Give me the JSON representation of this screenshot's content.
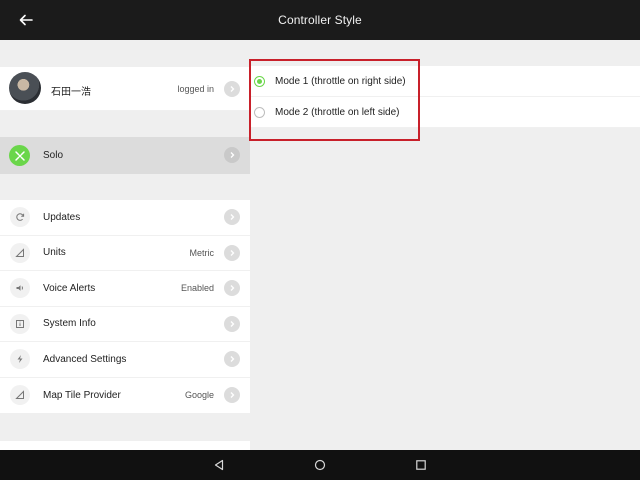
{
  "header": {
    "title": "Controller Style"
  },
  "profile": {
    "name": "石田一浩",
    "status": "logged in"
  },
  "solo": {
    "label": "Solo"
  },
  "settings": [
    {
      "label": "Updates",
      "value": "",
      "icon": "refresh-icon"
    },
    {
      "label": "Units",
      "value": "Metric",
      "icon": "ruler-icon"
    },
    {
      "label": "Voice Alerts",
      "value": "Enabled",
      "icon": "speaker-icon"
    },
    {
      "label": "System Info",
      "value": "",
      "icon": "info-icon"
    },
    {
      "label": "Advanced Settings",
      "value": "",
      "icon": "lightning-icon"
    },
    {
      "label": "Map Tile Provider",
      "value": "Google",
      "icon": "map-icon"
    }
  ],
  "modes": [
    {
      "label": "Mode 1 (throttle on right side)",
      "selected": true
    },
    {
      "label": "Mode 2 (throttle on left side)",
      "selected": false
    }
  ],
  "colors": {
    "accent": "#6ad64a",
    "highlight": "#c8202a",
    "topbar": "#1b1b1b"
  }
}
